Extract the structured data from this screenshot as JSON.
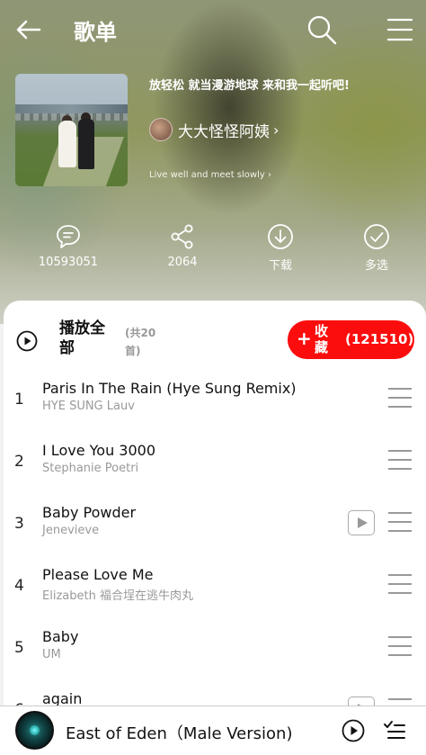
{
  "header": {
    "title": "歌单",
    "icons": {
      "back": "back-arrow-icon",
      "search": "search-icon",
      "menu": "menu-icon"
    }
  },
  "playlist": {
    "description": "放轻松 就当漫游地球 来和我一起听吧!",
    "creator": "大大怪怪阿姨",
    "subtitle": "Live well and meet slowly"
  },
  "actions": [
    {
      "icon": "comment-icon",
      "label": "10593051"
    },
    {
      "icon": "share-icon",
      "label": "2064"
    },
    {
      "icon": "download-icon",
      "label": "下载"
    },
    {
      "icon": "multi-select-icon",
      "label": "多选"
    }
  ],
  "list_header": {
    "play_all": "播放全部",
    "count": "(共20首)",
    "collect_plus": "+",
    "collect_label": "收藏",
    "collect_count": "(121510)"
  },
  "songs": [
    {
      "num": "1",
      "title": "Paris In The Rain (Hye Sung Remix)",
      "artist": "HYE SUNG   Lauv",
      "has_mv": false
    },
    {
      "num": "2",
      "title": "I Love You 3000",
      "artist": "Stephanie Poetri",
      "has_mv": false
    },
    {
      "num": "3",
      "title": "Baby Powder",
      "artist": "Jenevieve",
      "has_mv": true
    },
    {
      "num": "4",
      "title": "Please Love Me",
      "artist": "Elizabeth   福合埕在逃牛肉丸",
      "has_mv": false
    },
    {
      "num": "5",
      "title": "Baby",
      "artist": "UM",
      "has_mv": false
    },
    {
      "num": "6",
      "title": "again",
      "artist": "",
      "has_mv": true
    }
  ],
  "player": {
    "title": "East of Eden（Male Version)",
    "icons": {
      "play": "play-circle-icon",
      "list": "playlist-icon"
    }
  },
  "colors": {
    "accent": "#fb0d0d",
    "muted": "#999999"
  }
}
